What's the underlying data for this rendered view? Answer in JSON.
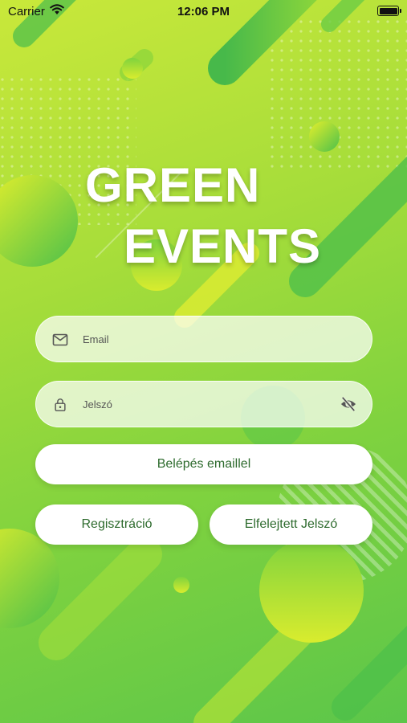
{
  "status_bar": {
    "carrier": "Carrier",
    "time": "12:06 PM"
  },
  "app": {
    "title_line1": "GREEN",
    "title_line2": "EVENTS"
  },
  "login_form": {
    "email_placeholder": "Email",
    "password_placeholder": "Jelszó",
    "email_icon": "mail-icon",
    "password_icon": "lock-icon",
    "visibility_icon": "eye-off-icon",
    "login_button": "Belépés emaillel",
    "register_button": "Regisztráció",
    "forgot_button": "Elfelejtett Jelszó"
  },
  "colors": {
    "accent": "#2e6b2e",
    "bg_top": "#c9e83a",
    "bg_bottom": "#5cc64a"
  }
}
